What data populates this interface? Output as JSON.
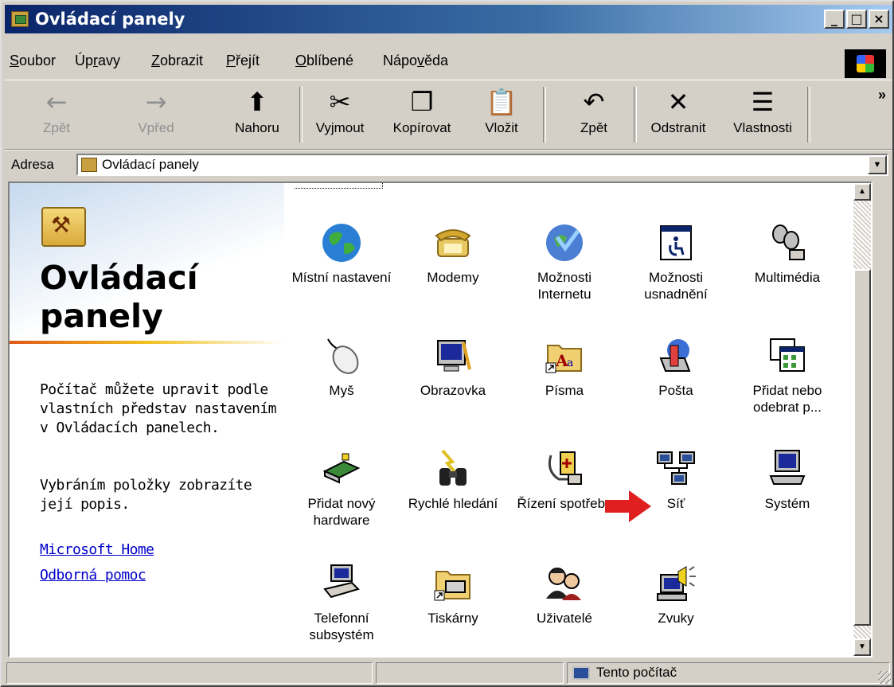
{
  "window": {
    "title": "Ovládací panely",
    "buttons": {
      "minimize": "_",
      "maximize": "□",
      "close": "×"
    }
  },
  "menu": [
    {
      "label": "Soubor",
      "ul": "S",
      "rest": "oubor"
    },
    {
      "label": "Úpravy",
      "pre": "Úp",
      "ul": "r",
      "rest": "avy"
    },
    {
      "label": "Zobrazit",
      "ul": "Z",
      "rest": "obrazit"
    },
    {
      "label": "Přejít",
      "ul": "P",
      "rest": "řejít"
    },
    {
      "label": "Oblíbené",
      "ul": "O",
      "rest": "blíbené"
    },
    {
      "label": "Nápověda",
      "pre": "Nápo",
      "ul": "v",
      "rest": "ěda"
    }
  ],
  "toolbar": {
    "back": {
      "label": "Zpět",
      "icon": "←"
    },
    "forward": {
      "label": "Vpřed",
      "icon": "→"
    },
    "up": {
      "label": "Nahoru",
      "icon": "⬆"
    },
    "cut": {
      "label": "Vyjmout",
      "icon": "✂"
    },
    "copy": {
      "label": "Kopírovat",
      "icon": "❐"
    },
    "paste": {
      "label": "Vložit",
      "icon": "📋"
    },
    "undo": {
      "label": "Zpět",
      "icon": "↶"
    },
    "delete": {
      "label": "Odstranit",
      "icon": "✕"
    },
    "properties": {
      "label": "Vlastnosti",
      "icon": "☰"
    },
    "more": "»"
  },
  "address": {
    "label": "Adresa",
    "value": "Ovládací panely"
  },
  "sidebar": {
    "title_line1": "Ovládací",
    "title_line2": "panely",
    "text1": "Počítač můžete upravit podle vlastních představ nastavením v Ovládacích panelech.",
    "text2": "Vybráním položky zobrazíte její popis.",
    "link1": "Microsoft Home",
    "link2": "Odborná pomoc"
  },
  "items": [
    {
      "label": "Místní nastavení",
      "icon": "globe-icon"
    },
    {
      "label": "Modemy",
      "icon": "telephone-icon"
    },
    {
      "label": "Možnosti Internetu",
      "icon": "internet-globe-icon"
    },
    {
      "label": "Možnosti usnadnění",
      "icon": "accessibility-icon"
    },
    {
      "label": "Multimédia",
      "icon": "multimedia-icon"
    },
    {
      "label": "Myš",
      "icon": "mouse-icon"
    },
    {
      "label": "Obrazovka",
      "icon": "display-icon"
    },
    {
      "label": "Písma",
      "icon": "fonts-folder-icon"
    },
    {
      "label": "Pošta",
      "icon": "mail-icon"
    },
    {
      "label": "Přidat nebo odebrat p...",
      "icon": "add-remove-programs-icon"
    },
    {
      "label": "Přidat nový hardware",
      "icon": "hardware-icon"
    },
    {
      "label": "Rychlé hledání",
      "icon": "binoculars-icon"
    },
    {
      "label": "Řízení spotřeby",
      "icon": "power-icon"
    },
    {
      "label": "Síť",
      "icon": "network-icon"
    },
    {
      "label": "Systém",
      "icon": "computer-icon"
    },
    {
      "label": "Telefonní subsystém",
      "icon": "telephony-icon"
    },
    {
      "label": "Tiskárny",
      "icon": "printers-folder-icon"
    },
    {
      "label": "Uživatelé",
      "icon": "users-icon"
    },
    {
      "label": "Zvuky",
      "icon": "sounds-icon"
    }
  ],
  "status": {
    "location": "Tento počítač"
  },
  "colors": {
    "titlebar_start": "#0a246a",
    "titlebar_end": "#a6caf0",
    "chrome": "#d4d0c8",
    "link": "#0000cc",
    "arrow": "#e02020"
  }
}
